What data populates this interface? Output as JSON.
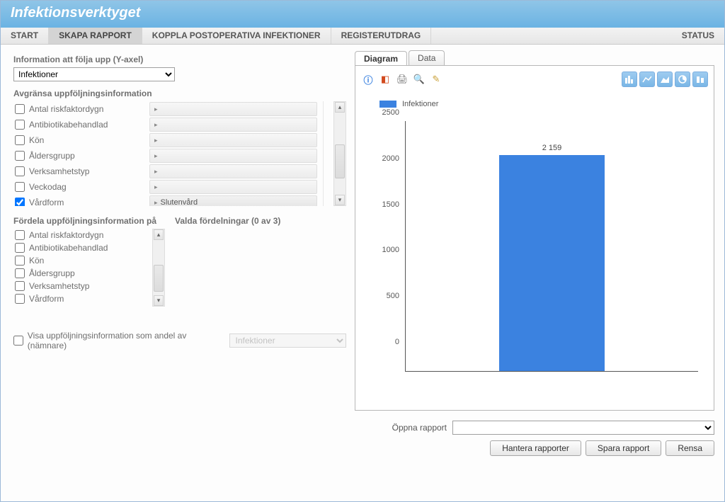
{
  "app_title": "Infektionsverktyget",
  "menu": {
    "start": "START",
    "skapa": "SKAPA RAPPORT",
    "koppla": "KOPPLA POSTOPERATIVA INFEKTIONER",
    "register": "REGISTERUTDRAG",
    "status": "STATUS"
  },
  "left": {
    "y_label": "Information att följa upp (Y-axel)",
    "y_select": "Infektioner",
    "filter_label": "Avgränsa uppföljningsinformation",
    "filters": [
      {
        "label": "Antal riskfaktordygn",
        "checked": false,
        "value": ""
      },
      {
        "label": "Antibiotikabehandlad",
        "checked": false,
        "value": ""
      },
      {
        "label": "Kön",
        "checked": false,
        "value": ""
      },
      {
        "label": "Åldersgrupp",
        "checked": false,
        "value": ""
      },
      {
        "label": "Verksamhetstyp",
        "checked": false,
        "value": ""
      },
      {
        "label": "Veckodag",
        "checked": false,
        "value": ""
      },
      {
        "label": "Vårdform",
        "checked": true,
        "value": "Slutenvård"
      }
    ],
    "dist_label": "Fördela uppföljningsinformation på",
    "dist_selected_label": "Valda fördelningar (0 av 3)",
    "dist_items": [
      "Antal riskfaktordygn",
      "Antibiotikabehandlad",
      "Kön",
      "Åldersgrupp",
      "Verksamhetstyp",
      "Vårdform"
    ],
    "share_label": "Visa uppföljningsinformation som andel av (nämnare)",
    "share_select": "Infektioner"
  },
  "tabs": {
    "diagram": "Diagram",
    "data": "Data"
  },
  "legend": "Infektioner",
  "footer": {
    "open_label": "Öppna rapport",
    "hantera": "Hantera rapporter",
    "spara": "Spara rapport",
    "rensa": "Rensa"
  },
  "chart_data": {
    "type": "bar",
    "categories": [
      ""
    ],
    "values": [
      2159
    ],
    "value_label": "2 159",
    "ylim": [
      0,
      2500
    ],
    "yticks": [
      0,
      500,
      1000,
      1500,
      2000,
      2500
    ],
    "legend": "Infektioner"
  }
}
